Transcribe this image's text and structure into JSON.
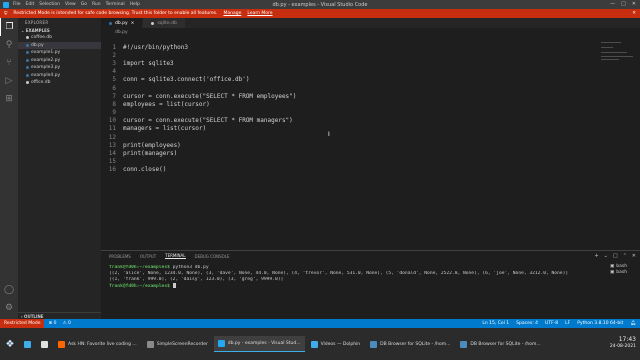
{
  "window": {
    "title": "db.py - examples - Visual Studio Code",
    "menu": [
      "File",
      "Edit",
      "Selection",
      "View",
      "Go",
      "Run",
      "Terminal",
      "Help"
    ],
    "controls": [
      "—",
      "□",
      "✕"
    ]
  },
  "banner": {
    "message": "Restricted Mode is intended for safe code browsing. Trust this folder to enable all features.",
    "manage": "Manage",
    "learn_more": "Learn More",
    "close": "✕"
  },
  "activity_bar": {
    "icons": [
      "files-icon",
      "search-icon",
      "source-control-icon",
      "run-debug-icon",
      "extensions-icon"
    ],
    "bottom_icons": [
      "account-icon",
      "settings-gear-icon"
    ]
  },
  "sidebar": {
    "header": "EXPLORER",
    "folder": "EXAMPLES",
    "files": [
      {
        "name": "coffee.db",
        "color": "#c9c9c9"
      },
      {
        "name": "db.py",
        "color": "#3572a5"
      },
      {
        "name": "example1.py",
        "color": "#3572a5"
      },
      {
        "name": "example2.py",
        "color": "#3572a5"
      },
      {
        "name": "example3.py",
        "color": "#3572a5"
      },
      {
        "name": "example4.py",
        "color": "#3572a5"
      },
      {
        "name": "office.db",
        "color": "#c9c9c9"
      }
    ],
    "selected": "db.py",
    "outline": "OUTLINE"
  },
  "editor": {
    "tabs": [
      {
        "name": "db.py",
        "close": "×"
      },
      {
        "name": "sqlite.db",
        "close": ""
      }
    ],
    "breadcrumb": "db.py",
    "lines": [
      {
        "n": "1",
        "text": "#!/usr/bin/python3"
      },
      {
        "n": "2",
        "text": ""
      },
      {
        "n": "3",
        "text": "import sqlite3"
      },
      {
        "n": "4",
        "text": ""
      },
      {
        "n": "5",
        "text": "conn = sqlite3.connect('office.db')"
      },
      {
        "n": "6",
        "text": ""
      },
      {
        "n": "7",
        "text": "cursor = conn.execute(\"SELECT * FROM employees\")"
      },
      {
        "n": "8",
        "text": "employees = list(cursor)"
      },
      {
        "n": "9",
        "text": ""
      },
      {
        "n": "10",
        "text": "cursor = conn.execute(\"SELECT * FROM managers\")"
      },
      {
        "n": "11",
        "text": "managers = list(cursor)"
      },
      {
        "n": "12",
        "text": ""
      },
      {
        "n": "13",
        "text": "print(employees)"
      },
      {
        "n": "14",
        "text": "print(managers)"
      },
      {
        "n": "15",
        "text": ""
      },
      {
        "n": "16",
        "text": "conn.close()"
      }
    ]
  },
  "panel": {
    "tabs": [
      "PROBLEMS",
      "OUTPUT",
      "TERMINAL",
      "DEBUG CONSOLE"
    ],
    "active_tab": "TERMINAL",
    "actions": [
      "+",
      "⌄",
      "□",
      "⌃",
      "✕"
    ],
    "terminal": {
      "prompt": "frank@fd0h:~/examples$",
      "command": " python3 db.py",
      "output": [
        "[(2, 'alice', None, 1234.0, None), (3, 'dave', None, 44.0, None), (4, 'trevor', None, 531.0, None), (5, 'donald', None, 2522.0, None), (6, 'joe', None, 3212.0, None)]",
        "[(1, 'frank', 999.0), (2, 'daisy', 123.0), (3, 'greg', 9999.0)]"
      ]
    },
    "terminal_list": [
      "bash",
      "bash"
    ]
  },
  "statusbar": {
    "restricted": "Restricted Mode",
    "left": [
      "⊗ 0",
      "⚠ 0"
    ],
    "right": [
      "Ln 15, Col 1",
      "Spaces: 4",
      "UTF-8",
      "LF",
      "Python 3.8.10 64-bit"
    ]
  },
  "taskbar": {
    "items": [
      {
        "label": "",
        "color": "#3daee9"
      },
      {
        "label": "",
        "color": "#e0e0e0"
      },
      {
        "label": "Ask HN: Favorite live coding ...",
        "color": "#ff6600"
      },
      {
        "label": "SimpleScreenRecorder",
        "color": "#8a8a8a"
      },
      {
        "label": "db.py - examples - Visual Stud...",
        "color": "#23a9f2"
      },
      {
        "label": "Videos — Dolphin",
        "color": "#3daee9"
      },
      {
        "label": "DB Browser for SQLite - /hom...",
        "color": "#4b8bbe"
      },
      {
        "label": "DB Browser for SQLite - /hom...",
        "color": "#4b8bbe"
      }
    ],
    "active_index": 4,
    "time": "17:43",
    "date": "24-08-2021"
  }
}
